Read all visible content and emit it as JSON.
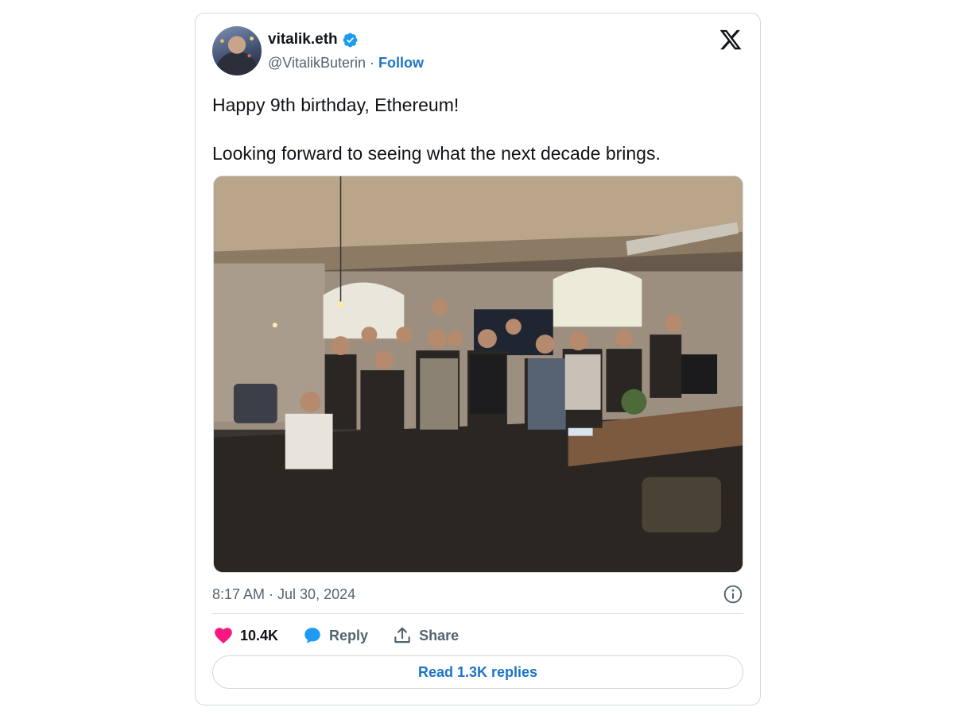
{
  "author": {
    "display_name": "vitalik.eth",
    "handle": "@VitalikButerin",
    "separator": "·",
    "follow_label": "Follow",
    "verified": true,
    "avatar_icon": "avatar-photo"
  },
  "platform_logo": "x-logo-icon",
  "tweet": {
    "text_line1": "Happy 9th birthday, Ethereum!",
    "text_line2": "Looking forward to seeing what the next decade brings.",
    "timestamp": "8:17 AM · Jul 30, 2024"
  },
  "actions": {
    "likes": "10.4K",
    "reply_label": "Reply",
    "share_label": "Share"
  },
  "read_replies_label": "Read 1.3K replies",
  "colors": {
    "accent_blue": "#1d74c4",
    "like_pink": "#f91880",
    "reply_blue": "#1d9bf0",
    "verified_blue": "#1d9bf0",
    "muted_text": "#536471",
    "border": "#cfd9de"
  }
}
